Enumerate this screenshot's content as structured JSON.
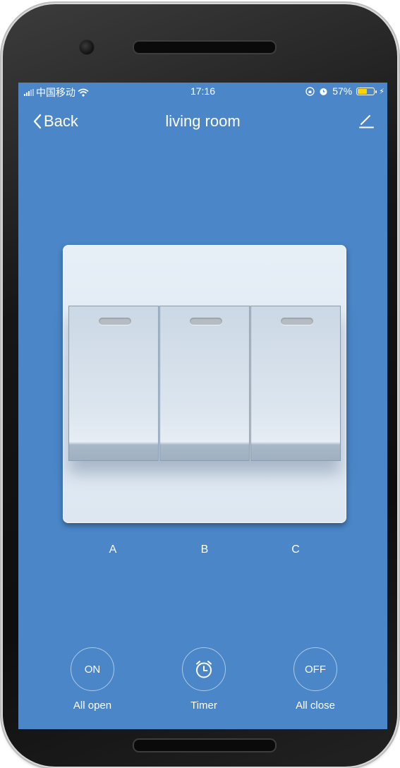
{
  "status_bar": {
    "carrier": "中国移动",
    "time": "17:16",
    "battery_percent": "57%",
    "battery_level": 0.57,
    "icons": [
      "signal-icon",
      "wifi-icon",
      "orientation-lock-icon",
      "alarm-icon",
      "battery-icon",
      "charging-icon"
    ]
  },
  "nav": {
    "back_label": "Back",
    "title": "living room",
    "edit_icon": "pencil-icon"
  },
  "switch_panel": {
    "keys": [
      {
        "label": "A"
      },
      {
        "label": "B"
      },
      {
        "label": "C"
      }
    ]
  },
  "actions": [
    {
      "badge": "ON",
      "label": "All open"
    },
    {
      "icon": "alarm-clock-icon",
      "label": "Timer"
    },
    {
      "badge": "OFF",
      "label": "All close"
    }
  ],
  "colors": {
    "screen_background": "#4a86c8",
    "battery_fill": "#ffd400",
    "text": "#ffffff"
  }
}
